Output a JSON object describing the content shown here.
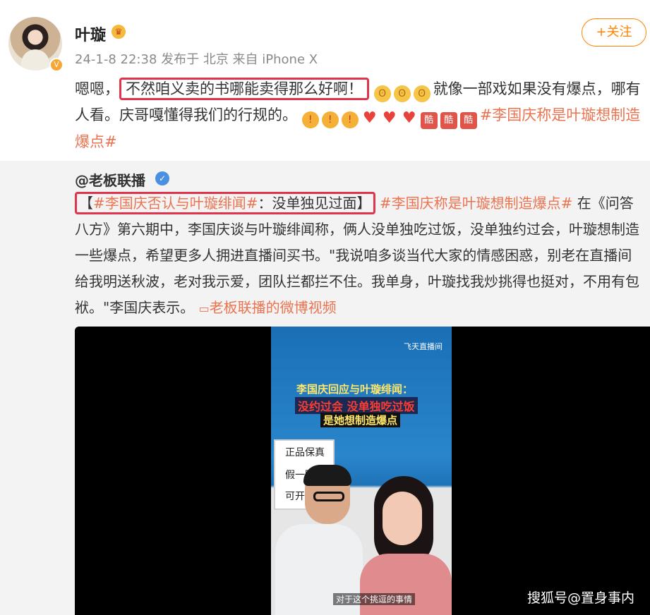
{
  "header": {
    "username": "叶璇",
    "crown_icon": "crown-icon",
    "meta": "24-1-8 22:38  发布于 北京  来自 iPhone X",
    "follow_label": "+关注"
  },
  "post": {
    "t1": "嗯嗯，",
    "highlight": "不然咱义卖的书哪能卖得那么好啊！",
    "t2": "就像一部戏如果没有爆点，哪有人看。庆哥嘎懂得我们的行规的。",
    "topic": "#李国庆称是叶璇想制造爆点#",
    "emoji_laugh": "😁",
    "emoji_shock": "😱",
    "emoji_heart": "❤",
    "emoji_ku": "酷"
  },
  "repost": {
    "author": "@老板联播",
    "hl_open": "【",
    "hl_topic": "#李国庆否认与叶璇绯闻#",
    "hl_text": "：没单独见过面】",
    "topic2": "#李国庆称是叶璇想制造爆点#",
    "body": " 在《问答八方》第六期中，李国庆谈与叶璇绯闻称，俩人没单独吃过饭，没单独约过会，叶璇想制造一些爆点，希望更多人拥进直播间买书。\"我说咱多谈当代大家的情感困惑，别老在直播间给我明送秋波，老对我示爱，团队拦都拦不住。我单身，叶璇找我炒挑得也挺对，不用有包袱。\"李国庆表示。",
    "video_link": "老板联播的微博视频"
  },
  "video": {
    "logo": "飞天直播间",
    "caption1": "李国庆回应与叶璇绯闻：",
    "caption2": "没约过会 没单独吃过饭",
    "caption3": "是她想制造爆点",
    "banner": [
      "正品保真",
      "假一赔",
      "可开"
    ],
    "subtitle": "对于这个挑逗的事情"
  },
  "watermark": "搜狐号@置身事内"
}
